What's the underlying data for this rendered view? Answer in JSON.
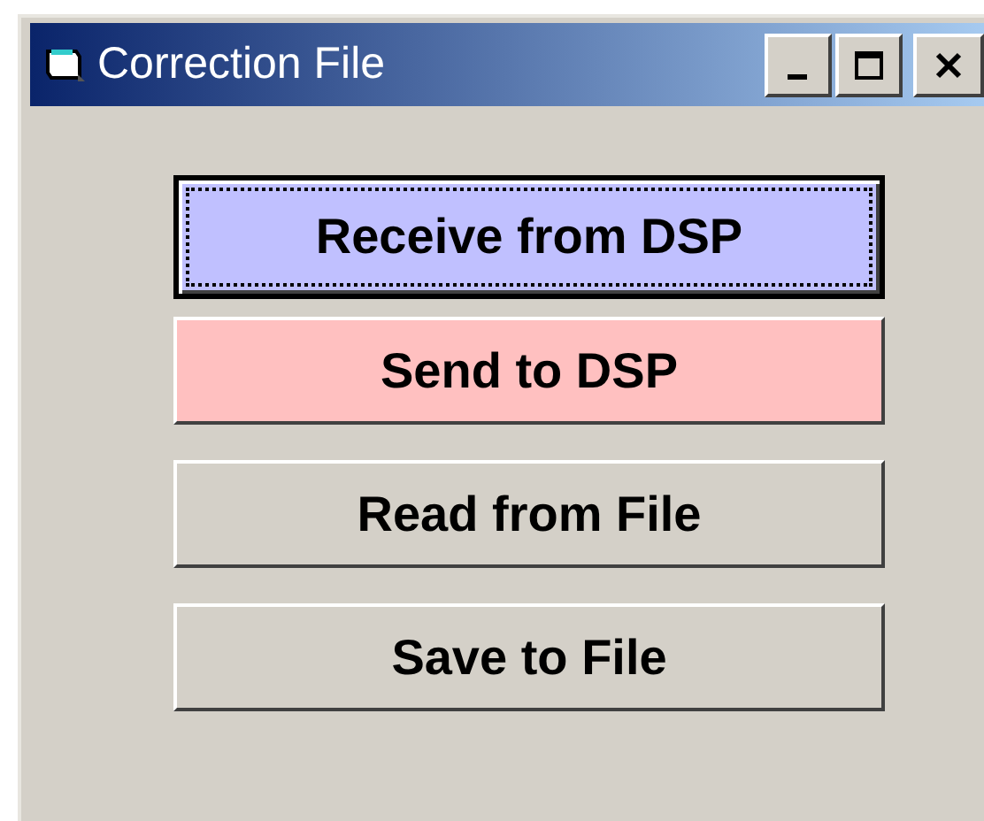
{
  "window": {
    "title": "Correction File"
  },
  "buttons": [
    {
      "label": "Receive from DSP",
      "color": "#c0c0ff",
      "focused": true
    },
    {
      "label": "Send to DSP",
      "color": "#ffc0c0",
      "focused": false
    },
    {
      "label": "Read from File",
      "color": "#d4d0c8",
      "focused": false
    },
    {
      "label": "Save to File",
      "color": "#d4d0c8",
      "focused": false
    }
  ]
}
